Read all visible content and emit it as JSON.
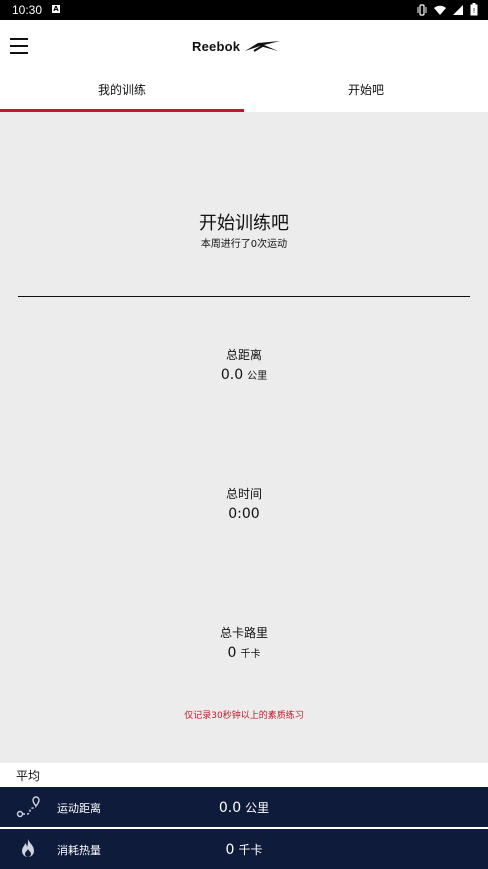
{
  "status_bar": {
    "time": "10:30",
    "notification_icon": "a-icon",
    "right_icons": [
      "vibrate-icon",
      "wifi-icon",
      "signal-icon",
      "battery-icon"
    ]
  },
  "app_bar": {
    "menu_icon": "menu-icon",
    "logo_text": "Reebok"
  },
  "tabs": [
    {
      "label": "我的训练",
      "active": true
    },
    {
      "label": "开始吧",
      "active": false
    }
  ],
  "summary": {
    "title": "开始训练吧",
    "subtitle": "本周进行了0次运动"
  },
  "stats": {
    "distance": {
      "label": "总距离",
      "value": "0.0",
      "unit": "公里"
    },
    "time": {
      "label": "总时间",
      "value": "0:00"
    },
    "calories": {
      "label": "总卡路里",
      "value": "0",
      "unit": "千卡"
    }
  },
  "note": "仅记录30秒钟以上的素质练习",
  "average": {
    "label": "平均",
    "rows": [
      {
        "icon": "route-icon",
        "name": "运动距离",
        "value": "0.0",
        "unit": "公里"
      },
      {
        "icon": "flame-icon",
        "name": "消耗热量",
        "value": "0",
        "unit": "千卡"
      }
    ]
  },
  "colors": {
    "accent": "#c0192b",
    "navy": "#0f1b3b",
    "panel": "#ececec"
  }
}
